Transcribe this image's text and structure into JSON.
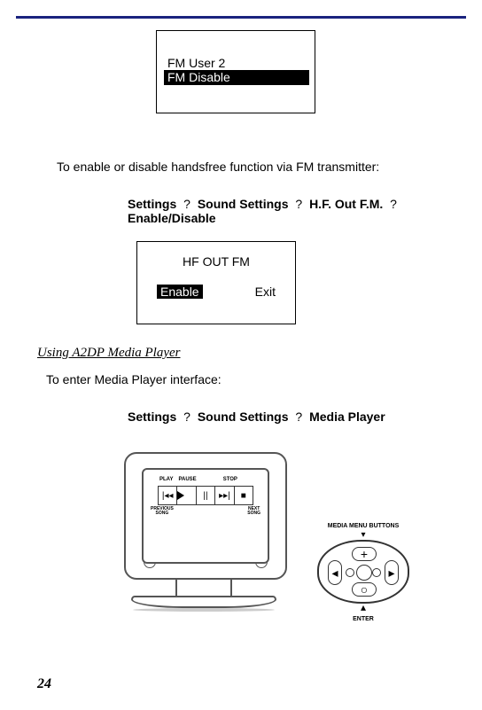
{
  "box1": {
    "line1": "FM User 2",
    "line2": "FM Disable"
  },
  "para1": "To enable or disable handsfree function via FM transmitter:",
  "nav1": {
    "a": "Settings",
    "q1": "?",
    "b": "Sound Settings",
    "q2": "?",
    "c": "H.F. Out F.M.",
    "q3": "?",
    "d": "Enable/Disable"
  },
  "box2": {
    "title": "HF OUT FM",
    "enable": "Enable",
    "exit": "Exit"
  },
  "section": "Using A2DP Media Player",
  "para2": "To enter Media Player interface:",
  "nav2": {
    "a": "Settings",
    "q1": "?",
    "b": "Sound Settings",
    "q2": "?",
    "c": "Media Player"
  },
  "monitor": {
    "play": "PLAY",
    "pause": "PAUSE",
    "stop": "STOP",
    "prev1": "PREVIOUS",
    "prev2": "SONG",
    "next1": "NEXT",
    "next2": "SONG",
    "btn_prev": "|◂◂",
    "btn_pause": "||",
    "btn_next": "▸▸|",
    "btn_stop": "■"
  },
  "remote": {
    "top": "MEDIA MENU BUTTONS",
    "bot": "ENTER",
    "left": "◂",
    "right": "▸",
    "up": "+",
    "down": "○"
  },
  "page": "24"
}
